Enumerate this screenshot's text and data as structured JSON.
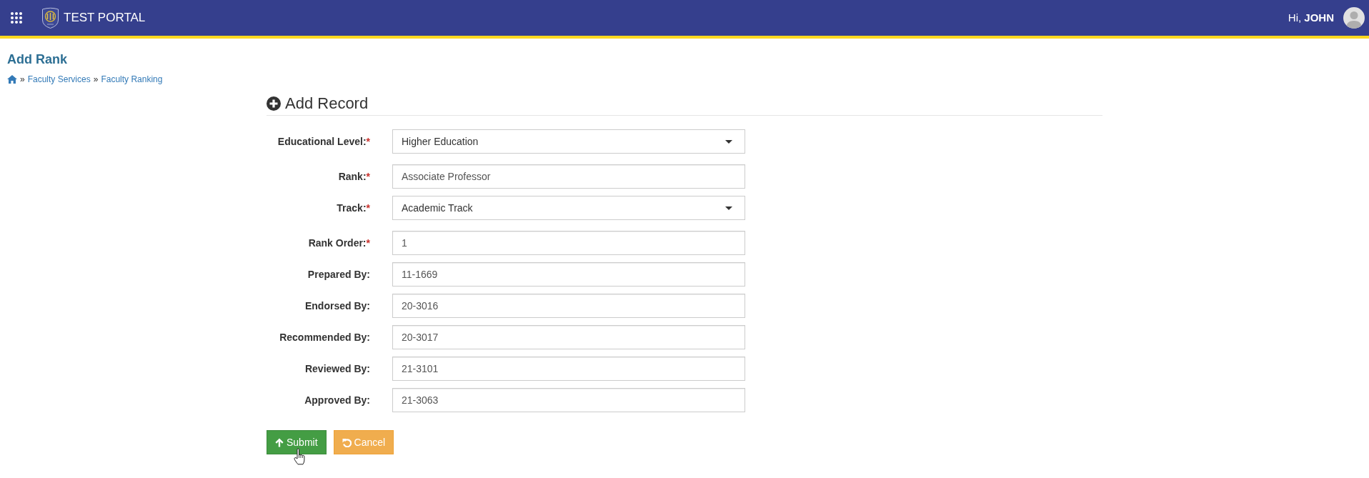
{
  "header": {
    "title": "TEST PORTAL",
    "greeting": "Hi, **JOHN**"
  },
  "page": {
    "title": "Add Rank",
    "breadcrumb": [
      {
        "kind": "home"
      },
      {
        "kind": "separator",
        "text": "»"
      },
      {
        "kind": "link",
        "text": "Faculty Services"
      },
      {
        "kind": "separator",
        "text": "»"
      },
      {
        "kind": "link",
        "text": "Faculty Ranking"
      }
    ]
  },
  "form": {
    "title": "Add Record",
    "fields": [
      {
        "label": "Educational Level:",
        "required_mark": "*",
        "kind": "select",
        "value": "Higher Education"
      },
      {
        "label": "Rank:",
        "required_mark": "*",
        "kind": "text",
        "value": "Associate Professor"
      },
      {
        "label": "Track:",
        "required_mark": "*",
        "kind": "select",
        "value": "Academic Track"
      },
      {
        "label": "Rank Order:",
        "required_mark": "*",
        "kind": "text",
        "value": "1"
      },
      {
        "label": "Prepared By:",
        "kind": "text",
        "value": "11-1669"
      },
      {
        "label": "Endorsed By:",
        "kind": "text",
        "value": "20-3016"
      },
      {
        "label": "Recommended By:",
        "kind": "text",
        "value": "20-3017"
      },
      {
        "label": "Reviewed By:",
        "kind": "text",
        "value": "21-3101"
      },
      {
        "label": "Approved By:",
        "kind": "text",
        "value": "21-3063"
      }
    ]
  },
  "buttons": [
    {
      "kind": "submit",
      "label": "Submit"
    },
    {
      "kind": "cancel",
      "label": "Cancel"
    }
  ]
}
